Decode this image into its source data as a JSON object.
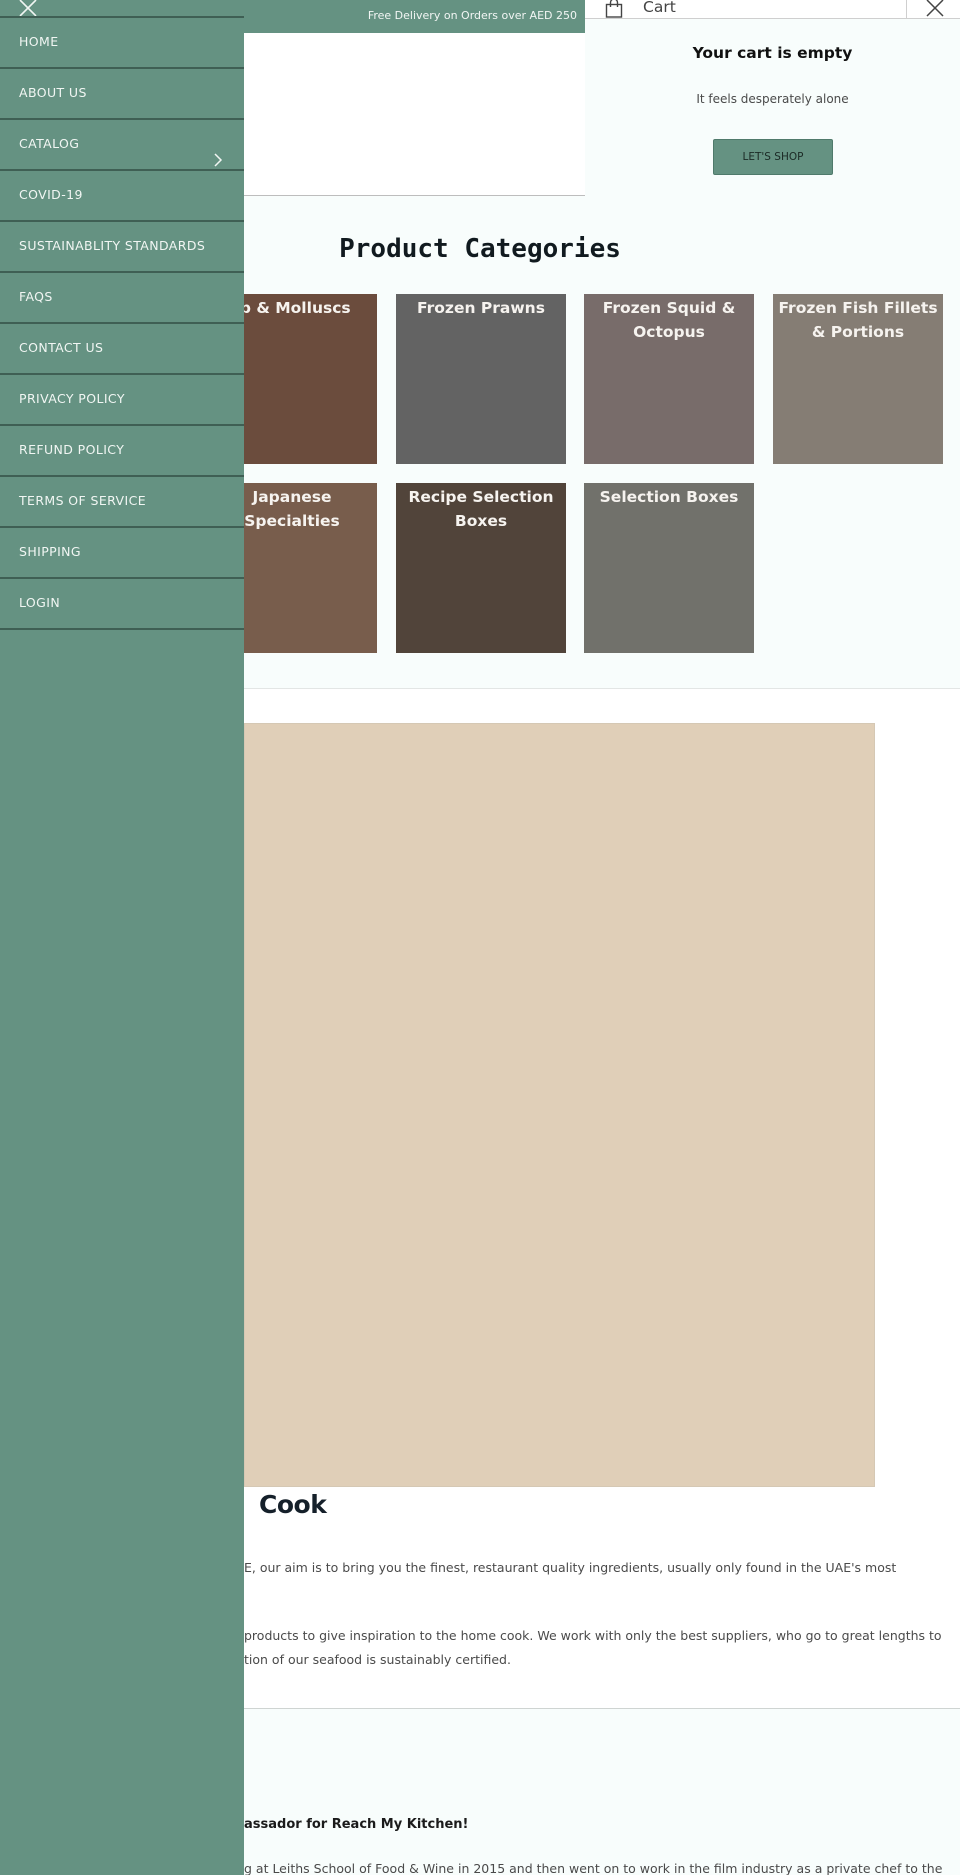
{
  "announcement": {
    "text": "Free Delivery on Orders over AED 250"
  },
  "drawer": {
    "close_icon": "close-icon",
    "items": [
      {
        "label": "Home"
      },
      {
        "label": "About Us"
      },
      {
        "label": "Catalog",
        "has_submenu": true
      },
      {
        "label": "COVID-19"
      },
      {
        "label": "Sustainablity Standards"
      },
      {
        "label": "FAQs"
      },
      {
        "label": "Contact Us"
      },
      {
        "label": "Privacy Policy"
      },
      {
        "label": "Refund Policy"
      },
      {
        "label": "Terms of Service"
      },
      {
        "label": "Shipping"
      },
      {
        "label": "Login"
      }
    ]
  },
  "cart": {
    "title": "Cart",
    "empty_title": "Your cart is empty",
    "empty_subtitle": "It feels desperately alone",
    "shop_button": "LET'S SHOP"
  },
  "categories": {
    "title": "Product Categories",
    "tiles": [
      {
        "lines": [
          "ab & Molluscs"
        ],
        "color": "#6b4c3d"
      },
      {
        "lines": [
          "Frozen Prawns"
        ],
        "color": "#636363"
      },
      {
        "lines": [
          "Frozen Squid &",
          "Octopus"
        ],
        "color": "#786c6a"
      },
      {
        "lines": [
          "Frozen Fish Fillets",
          "& Portions"
        ],
        "color": "#857d74"
      },
      {
        "lines": [
          "Japanese",
          "Specialties"
        ],
        "color": "#785d4c"
      },
      {
        "lines": [
          "Recipe Selection",
          "Boxes"
        ],
        "color": "#51443a"
      },
      {
        "lines": [
          "Selection Boxes"
        ],
        "color": "#71716b"
      }
    ]
  },
  "about": {
    "heading": "Cook",
    "paragraph1_line1": "E, our aim is to bring you the finest, restaurant quality ingredients, usually only found in the UAE's most",
    "paragraph2_line1": "products to give inspiration to the home cook. We work with only the best suppliers, who go to great lengths to",
    "paragraph2_line2": "tion of our seafood is sustainably certified."
  },
  "ambassador": {
    "title": "assador for Reach My Kitchen!",
    "text": "g at Leiths School of Food & Wine in 2015 and then went on to work in the film industry as a private chef to the"
  }
}
